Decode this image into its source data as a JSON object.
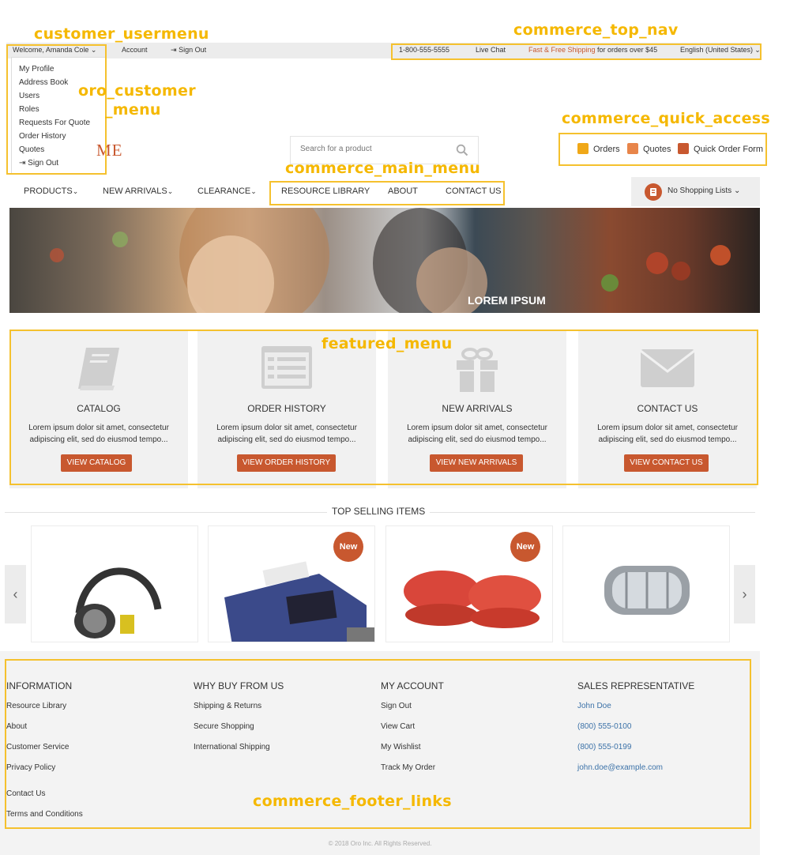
{
  "annotations": {
    "usermenu": "customer_usermenu",
    "top_nav": "commerce_top_nav",
    "customer_menu_1": "oro_customer",
    "customer_menu_2": "_menu",
    "quick_access": "commerce_quick_access",
    "main_menu": "commerce_main_menu",
    "featured_menu": "featured_menu",
    "footer_links": "commerce_footer_links"
  },
  "topbar": {
    "welcome": "Welcome, Amanda Cole",
    "account": "Account",
    "sign_out": "Sign Out",
    "phone": "1-800-555-5555",
    "live_chat": "Live Chat",
    "shipping_red": "Fast & Free Shipping",
    "shipping_rest": " for orders over $45",
    "language": "English (United States)"
  },
  "user_menu": [
    "My Profile",
    "Address Book",
    "Users",
    "Roles",
    "Requests For Quote",
    "Order History",
    "Quotes",
    "Sign Out"
  ],
  "logo_fragment": "ME",
  "search": {
    "placeholder": "Search for a product"
  },
  "quick_access": [
    {
      "label": "Orders",
      "color": "#f0a818"
    },
    {
      "label": "Quotes",
      "color": "#e8854a"
    },
    {
      "label": "Quick Order Form",
      "color": "#c8582f"
    }
  ],
  "main_menu": {
    "products": "PRODUCTS",
    "new_arrivals": "NEW ARRIVALS",
    "clearance": "CLEARANCE",
    "resource_library": "RESOURCE LIBRARY",
    "about": "ABOUT",
    "contact_us": "CONTACT US"
  },
  "cart": {
    "label": "No Shopping Lists"
  },
  "hero": {
    "title": "LOREM IPSUM"
  },
  "featured": [
    {
      "title": "CATALOG",
      "text1": "Lorem ipsum dolor sit amet, consectetur",
      "text2": "adipiscing elit, sed do eiusmod tempo...",
      "button": "VIEW CATALOG",
      "icon": "book-icon"
    },
    {
      "title": "ORDER HISTORY",
      "text1": "Lorem ipsum dolor sit amet, consectetur",
      "text2": "adipiscing elit, sed do eiusmod tempo...",
      "button": "VIEW ORDER HISTORY",
      "icon": "list-icon"
    },
    {
      "title": "NEW ARRIVALS",
      "text1": "Lorem ipsum dolor sit amet, consectetur",
      "text2": "adipiscing elit, sed do eiusmod tempo...",
      "button": "VIEW NEW ARRIVALS",
      "icon": "gift-icon"
    },
    {
      "title": "CONTACT US",
      "text1": "Lorem ipsum dolor sit amet, consectetur",
      "text2": "adipiscing elit, sed do eiusmod tempo...",
      "button": "VIEW CONTACT US",
      "icon": "envelope-icon"
    }
  ],
  "top_selling": {
    "title": "TOP SELLING ITEMS",
    "badge": "New"
  },
  "footer": {
    "information": {
      "heading": "INFORMATION",
      "links": [
        "Resource Library",
        "About",
        "Customer Service",
        "Privacy Policy",
        "Contact Us",
        "Terms and Conditions"
      ]
    },
    "why_buy": {
      "heading": "WHY BUY FROM US",
      "links": [
        "Shipping & Returns",
        "Secure Shopping",
        "International Shipping"
      ]
    },
    "my_account": {
      "heading": "MY ACCOUNT",
      "links": [
        "Sign Out",
        "View Cart",
        "My Wishlist",
        "Track My Order"
      ]
    },
    "sales_rep": {
      "heading": "SALES REPRESENTATIVE",
      "links": [
        "John Doe",
        "(800) 555-0100",
        "(800) 555-0199",
        "john.doe@example.com"
      ]
    },
    "copyright": "© 2018 Oro Inc. All Rights Reserved."
  }
}
